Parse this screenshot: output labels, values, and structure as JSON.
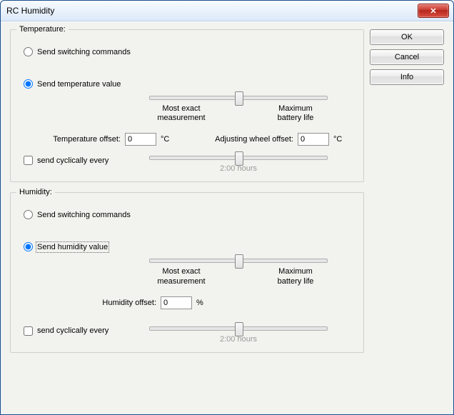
{
  "window": {
    "title": "RC Humidity"
  },
  "buttons": {
    "ok": "OK",
    "cancel": "Cancel",
    "info": "Info"
  },
  "temperature": {
    "legend": "Temperature:",
    "opt_switching": "Send switching commands",
    "opt_value": "Send temperature value",
    "slider_left": "Most exact\nmeasurement",
    "slider_right": "Maximum\nbattery life",
    "offset_label": "Temperature offset:",
    "offset_value": "0",
    "offset_unit": "°C",
    "wheel_label": "Adjusting wheel offset:",
    "wheel_value": "0",
    "wheel_unit": "°C",
    "cyclic_label": "send cyclically every",
    "cyclic_caption": "2:00 hours"
  },
  "humidity": {
    "legend": "Humidity:",
    "opt_switching": "Send switching commands",
    "opt_value": "Send humidity value",
    "slider_left": "Most exact\nmeasurement",
    "slider_right": "Maximum\nbattery life",
    "offset_label": "Humidity offset:",
    "offset_value": "0",
    "offset_unit": "%",
    "cyclic_label": "send cyclically every",
    "cyclic_caption": "2:00 hours"
  }
}
